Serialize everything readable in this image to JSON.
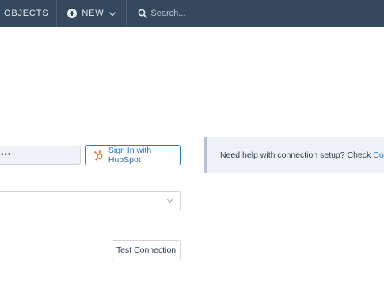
{
  "topnav": {
    "objects_label": "OBJECTS",
    "new_label": "NEW",
    "search_placeholder": "Search..."
  },
  "connection": {
    "token_value": "•••",
    "signin_label": "Sign In with HubSpot",
    "help_text": "Need help with connection setup? Check",
    "help_link": "Connectin",
    "select_value": "",
    "test_button_label": "Test Connection"
  },
  "colors": {
    "nav_bg": "#34495e",
    "accent": "#2f7bbf",
    "hubspot_orange": "#f57722"
  },
  "icons": {
    "new": "plus-circle-icon",
    "new_dropdown": "chevron-down-icon",
    "search": "search-icon",
    "hubspot": "hubspot-sprocket-icon",
    "select_dropdown": "chevron-down-icon"
  }
}
